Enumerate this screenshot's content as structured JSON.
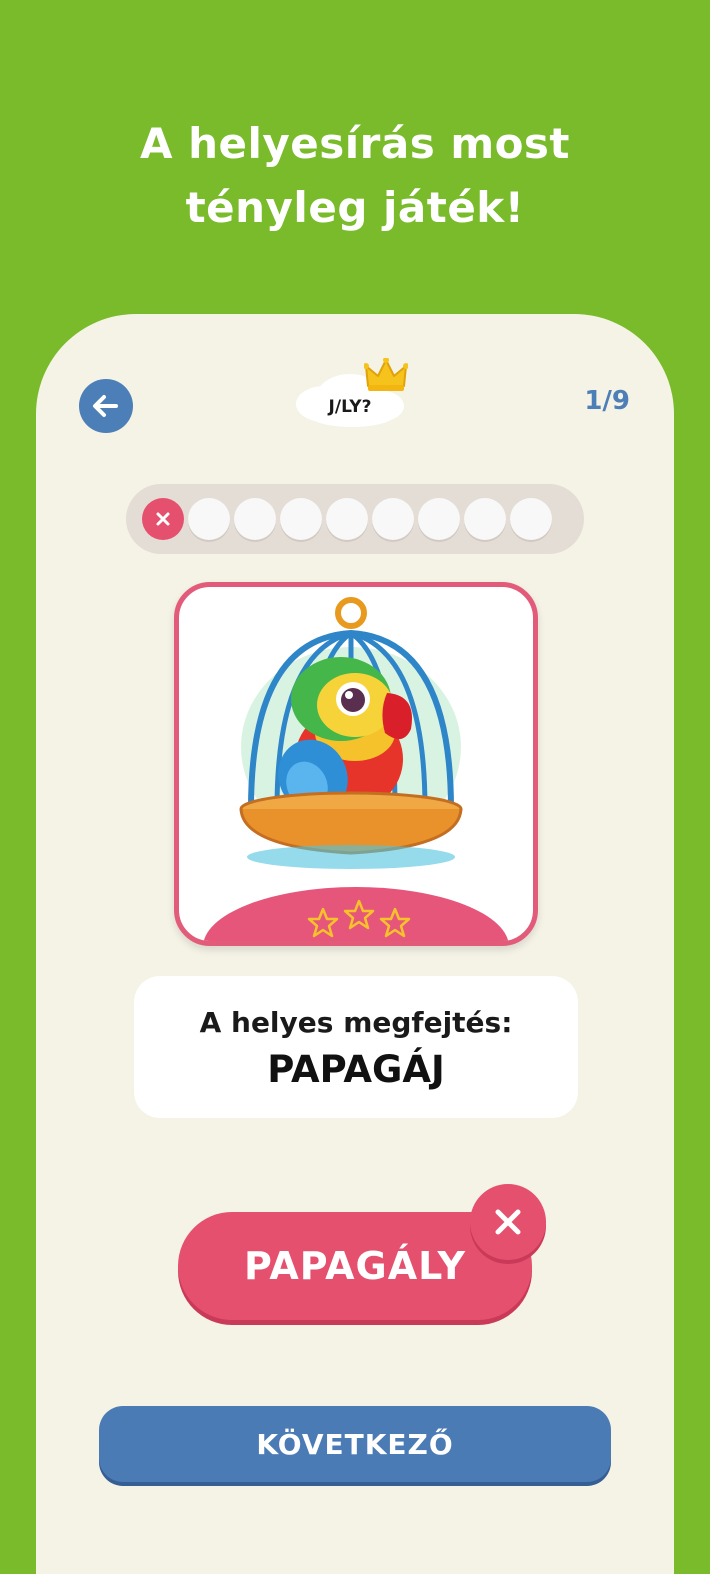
{
  "headline": {
    "line1": "A helyesírás most",
    "line2": "tényleg játék!"
  },
  "header": {
    "badge": "J/LY?",
    "counter": "1/9"
  },
  "progress": {
    "total": 9,
    "current": 1,
    "results": [
      "wrong",
      "pending",
      "pending",
      "pending",
      "pending",
      "pending",
      "pending",
      "pending",
      "pending"
    ]
  },
  "picture": {
    "subject": "parrot-in-cage",
    "stars": 3
  },
  "answer": {
    "label": "A helyes megfejtés:",
    "word": "PAPAGÁJ"
  },
  "choice": {
    "label": "PAPAGÁLY",
    "status": "wrong"
  },
  "next_button": {
    "label": "KÖVETKEZŐ"
  },
  "colors": {
    "background": "#79bb2a",
    "panel": "#f5f3e6",
    "accent_red": "#e5506e",
    "accent_blue": "#4b7bb5"
  }
}
